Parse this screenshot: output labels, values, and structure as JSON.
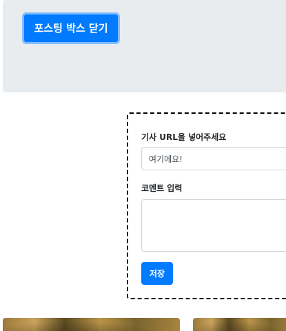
{
  "header": {
    "toggle_button_label": "포스팅 박스 닫기"
  },
  "post_box": {
    "url_label": "기사 URL을 넣어주세요",
    "url_value": "여기에요!",
    "comment_label": "코멘트 입력",
    "comment_value": "",
    "save_button_label": "저장"
  },
  "colors": {
    "primary": "#007bff",
    "jumbotron_bg": "#e9ecef"
  }
}
